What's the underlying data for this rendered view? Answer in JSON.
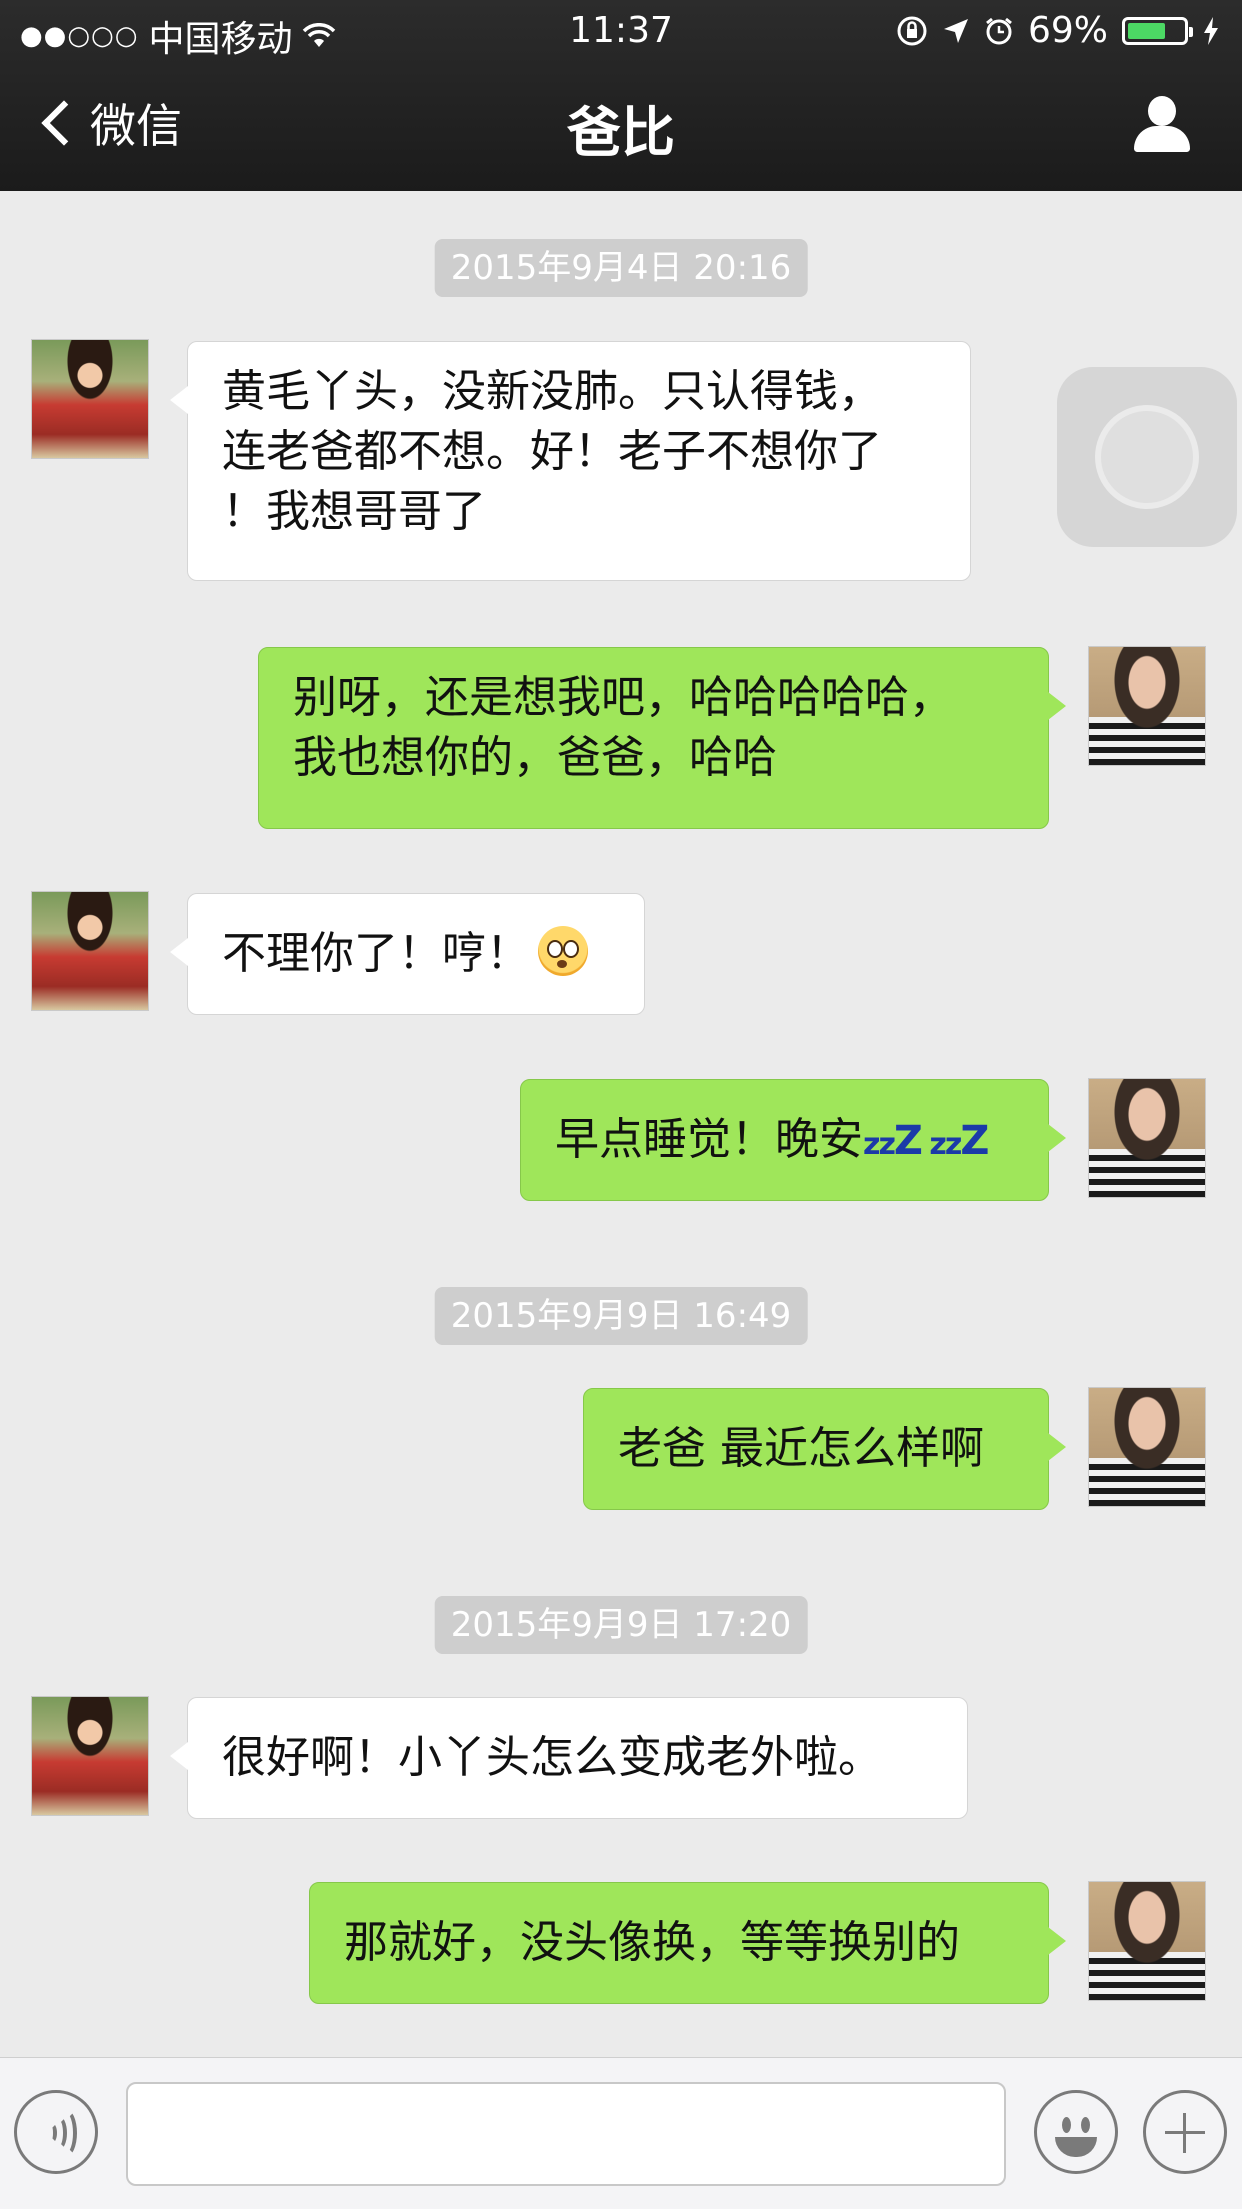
{
  "status_bar": {
    "signal": "●●○○○",
    "carrier": "中国移动",
    "time": "11:37",
    "battery_text": "69%",
    "battery_level": 0.69
  },
  "nav": {
    "back_label": "微信",
    "title": "爸比"
  },
  "messages": [
    {
      "type": "timestamp",
      "text": "2015年9月4日 20:16"
    },
    {
      "type": "incoming",
      "text": "黄毛丫头，没新没肺。只认得钱，\n连老爸都不想。好！老子不想你了\n！我想哥哥了"
    },
    {
      "type": "outgoing",
      "text": "别呀，还是想我吧，哈哈哈哈哈，\n我也想你的，爸爸，哈哈"
    },
    {
      "type": "incoming",
      "text": "不理你了！哼！",
      "emoji": "astonished-face-emoji"
    },
    {
      "type": "outgoing",
      "text": "早点睡觉！晚安",
      "emoji": "zzz-emoji"
    },
    {
      "type": "timestamp",
      "text": "2015年9月9日 16:49"
    },
    {
      "type": "outgoing",
      "text": "老爸 最近怎么样啊"
    },
    {
      "type": "timestamp",
      "text": "2015年9月9日 17:20"
    },
    {
      "type": "incoming",
      "text": "很好啊！小丫头怎么变成老外啦。"
    },
    {
      "type": "outgoing",
      "text": "那就好，没头像换，等等换别的"
    }
  ],
  "colors": {
    "outgoing_bubble": "#9fe65a",
    "incoming_bubble": "#ffffff",
    "chat_background": "#ebebeb",
    "timestamp_bg": "#cecece"
  }
}
